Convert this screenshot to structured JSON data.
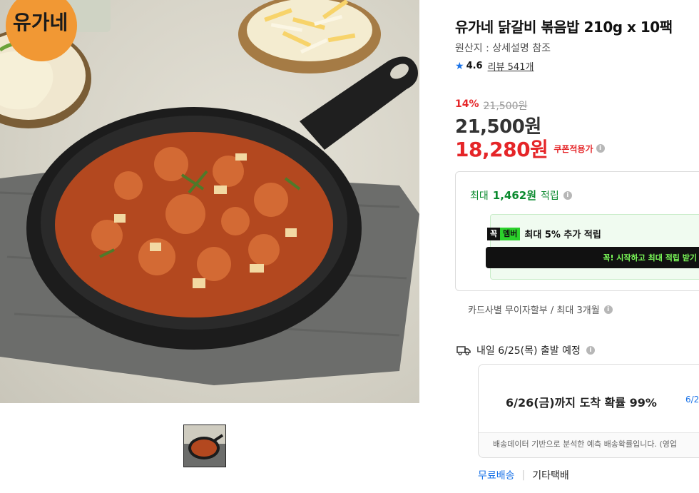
{
  "product": {
    "title": "유가네 닭갈비 볶음밥 210g x 10팩",
    "origin": "원산지 : 상세설명 참조",
    "brand_logo_text": "유가네",
    "rating": {
      "score": "4.6",
      "review_text": "리뷰 541개"
    }
  },
  "price": {
    "discount_rate": "14%",
    "original": "21,500원",
    "base": "21,500원",
    "coupon_price": "18,280원",
    "coupon_label": "쿠폰적용가"
  },
  "rewards": {
    "max_label_prefix": "최대",
    "max_amount": "1,462원",
    "max_label_suffix": "적립",
    "member_badge_a": "꼭",
    "member_badge_b": "멤버",
    "member_text": "최대 5% 추가 적립",
    "member_button": "꼭! 시작하고 최대 적립 받기"
  },
  "installment": "카드사별 무이자할부 / 최대 3개월",
  "shipping": {
    "departure": "내일 6/25(목) 출발 예정",
    "arrival": "6/26(금)까지 도착 확률 99%",
    "arrival_side": "6/2",
    "note": "배송데이터 기반으로 분석한 예측 배송확률입니다. (영업",
    "free": "무료배송",
    "separator": "|",
    "carrier": "기타택배"
  },
  "icons": {
    "star": "star-icon",
    "info": "info-icon",
    "truck": "truck-icon"
  },
  "colors": {
    "accent_red": "#e52528",
    "reward_green": "#0a8a2e",
    "link_blue": "#1a73e8"
  }
}
